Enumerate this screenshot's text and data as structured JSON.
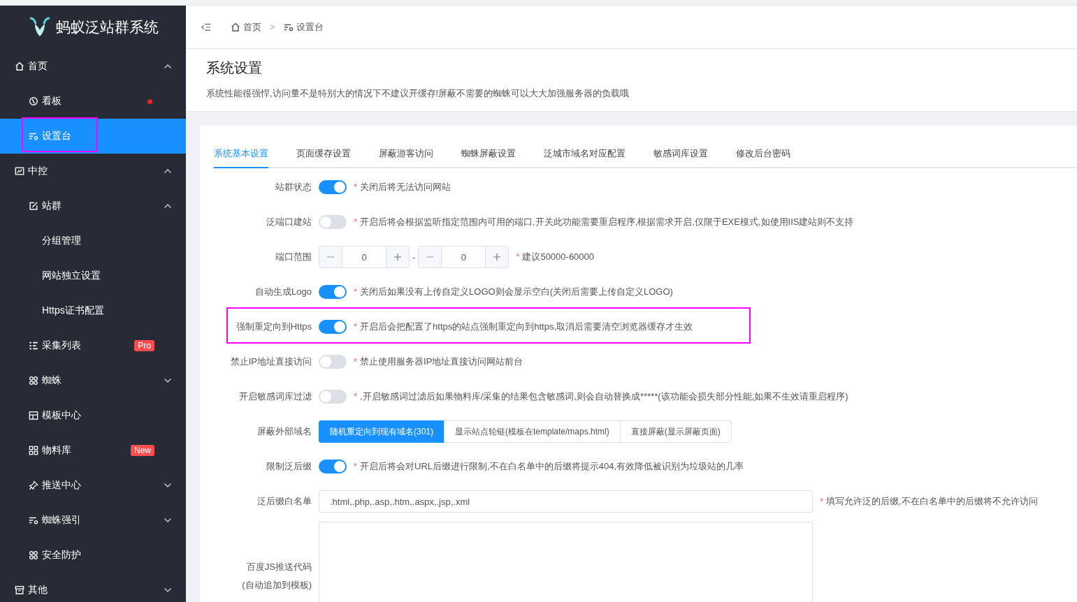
{
  "sidebar": {
    "logo_text": "蚂蚁泛站群系统",
    "items": [
      {
        "label": "首页",
        "expanded": true,
        "children": [
          {
            "label": "看板",
            "dot": true,
            "selected": false
          },
          {
            "label": "设置台",
            "selected": true,
            "highlighted": true
          }
        ]
      },
      {
        "label": "中控",
        "expanded": true,
        "children": [
          {
            "label": "站群",
            "expanded": true,
            "children": [
              {
                "label": "分组管理",
                "selected": false
              },
              {
                "label": "网站独立设置",
                "selected": false
              },
              {
                "label": "Https证书配置",
                "selected": false
              }
            ]
          },
          {
            "label": "采集列表",
            "badge": "Pro",
            "selected": false
          },
          {
            "label": "蜘蛛",
            "expanded": false
          },
          {
            "label": "模板中心",
            "selected": false
          },
          {
            "label": "物料库",
            "badge": "New",
            "selected": false
          },
          {
            "label": "推送中心",
            "expanded": false
          },
          {
            "label": "蜘蛛强引",
            "expanded": false
          },
          {
            "label": "安全防护",
            "selected": false
          }
        ]
      },
      {
        "label": "其他",
        "expanded": false
      }
    ]
  },
  "breadcrumb": {
    "items": [
      "首页",
      "设置台"
    ],
    "separator": ">"
  },
  "page": {
    "title": "系统设置",
    "description": "系统性能很强悍,访问量不是特别大的情况下不建议开缓存!屏蔽不需要的蜘蛛可以大大加强服务器的负载哦"
  },
  "tabs": [
    {
      "label": "系统基本设置",
      "selected": true
    },
    {
      "label": "页面缓存设置",
      "selected": false
    },
    {
      "label": "屏蔽游客访问",
      "selected": false
    },
    {
      "label": "蜘蛛屏蔽设置",
      "selected": false
    },
    {
      "label": "泛城市域名对应配置",
      "selected": false
    },
    {
      "label": "敏感词库设置",
      "selected": false
    },
    {
      "label": "修改后台密码",
      "selected": false
    }
  ],
  "form": [
    {
      "kind": "switch",
      "label": "站群状态",
      "on": true,
      "mark": "*",
      "note": "关闭后将无法访问网站"
    },
    {
      "kind": "switch",
      "label": "泛端口建站",
      "on": false,
      "mark": "*",
      "note": "开启后将会根据监听指定范围内可用的端口,开关此功能需要重启程序,根据需求开启,仅限于EXE模式,如使用IIS建站则不支持"
    },
    {
      "kind": "range",
      "label": "端口范围",
      "from": "0",
      "to": "0",
      "separator": "-",
      "mark": "*",
      "note": "建议50000-60000"
    },
    {
      "kind": "switch",
      "label": "自动生成Logo",
      "on": true,
      "mark": "*",
      "note": "关闭后如果没有上传自定义LOGO则会显示空白(关闭后需要上传自定义LOGO)"
    },
    {
      "kind": "switch",
      "label": "强制重定向到Https",
      "on": true,
      "highlighted": true,
      "mark": "*",
      "note": "开启后会把配置了https的站点强制重定向到https,取消后需要清空浏览器缓存才生效"
    },
    {
      "kind": "switch",
      "label": "禁止IP地址直接访问",
      "on": false,
      "mark": "*",
      "note": "禁止使用服务器IP地址直接访问网站前台"
    },
    {
      "kind": "switch",
      "label": "开启敏感词库过滤",
      "on": false,
      "mark": "*",
      "note": ",开启敏感词过滤后如果物料库/采集的结果包含敏感词,则会自动替换成*****(该功能会损失部分性能,如果不生效请重启程序)"
    },
    {
      "kind": "segmented",
      "label": "屏蔽外部域名",
      "options": [
        {
          "label": "随机重定向到现有域名(301)",
          "selected": true
        },
        {
          "label": "显示站点轮链(模板在template/maps.html)",
          "selected": false
        },
        {
          "label": "直接屏蔽(显示屏蔽页面)",
          "selected": false
        }
      ]
    },
    {
      "kind": "switch",
      "label": "限制泛后缀",
      "on": true,
      "mark": "*",
      "note": "开启后将会对URL后缀进行限制,不在白名单中的后缀将提示404,有效降低被识别为垃圾站的几率"
    },
    {
      "kind": "input",
      "label": "泛后缀白名单",
      "value": ".html,.php,.asp,.htm,.aspx,.jsp,.xml",
      "mark": "*",
      "note": "填写允许泛的后缀,不在白名单中的后缀将不允许访问"
    },
    {
      "kind": "textarea",
      "label": "百度JS推送代码",
      "sublabel": "(自动追加到模板)"
    }
  ]
}
